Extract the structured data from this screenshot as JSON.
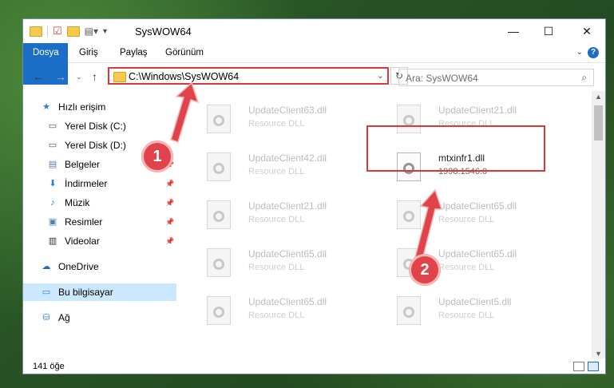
{
  "window": {
    "title": "SysWOW64",
    "minimize": "—",
    "maximize": "☐",
    "close": "✕"
  },
  "ribbon": {
    "tabs": [
      "Dosya",
      "Giriş",
      "Paylaş",
      "Görünüm"
    ],
    "help": "?"
  },
  "address": {
    "path": "C:\\Windows\\SysWOW64",
    "search_placeholder": "Ara: SysWOW64"
  },
  "sidebar": [
    {
      "label": "Hızlı erişim",
      "icon": "star-icon"
    },
    {
      "label": "Yerel Disk (C:)",
      "icon": "drive-icon"
    },
    {
      "label": "Yerel Disk (D:)",
      "icon": "drive-icon"
    },
    {
      "label": "Belgeler",
      "icon": "documents-icon"
    },
    {
      "label": "İndirmeler",
      "icon": "download-icon"
    },
    {
      "label": "Müzik",
      "icon": "music-icon"
    },
    {
      "label": "Resimler",
      "icon": "pictures-icon"
    },
    {
      "label": "Videolar",
      "icon": "video-icon"
    },
    {
      "label": "OneDrive",
      "icon": "cloud-icon"
    },
    {
      "label": "Bu bilgisayar",
      "icon": "computer-icon"
    },
    {
      "label": "Ağ",
      "icon": "network-icon"
    }
  ],
  "files": [
    {
      "name": "UpdateClient63.dll",
      "desc": "Resource DLL"
    },
    {
      "name": "UpdateClient21.dll",
      "desc": "Resource DLL"
    },
    {
      "name": "UpdateClient42.dll",
      "desc": "Resource DLL"
    },
    {
      "name": "mtxinfr1.dll",
      "desc": "1998.1546.0"
    },
    {
      "name": "UpdateClient21.dll",
      "desc": "Resource DLL"
    },
    {
      "name": "UpdateClient65.dll",
      "desc": "Resource DLL"
    },
    {
      "name": "UpdateClient65.dll",
      "desc": "Resource DLL"
    },
    {
      "name": "UpdateClient65.dll",
      "desc": "Resource DLL"
    },
    {
      "name": "UpdateClient65.dll",
      "desc": "Resource DLL"
    },
    {
      "name": "UpdateClient5.dll",
      "desc": "Resource DLL"
    }
  ],
  "status": {
    "count": "141 öğe"
  },
  "annotations": {
    "step1": "1",
    "step2": "2",
    "color": "#d9393c"
  }
}
